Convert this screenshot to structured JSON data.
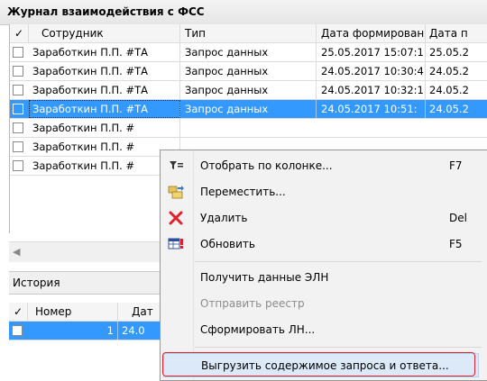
{
  "window": {
    "title": "Журнал взаимодействия с ФСС"
  },
  "grid": {
    "columns": [
      "✓",
      "Сотрудник",
      "Тип",
      "Дата формировани",
      "Дата п"
    ],
    "rows": [
      {
        "employee": "Заработкин П.П. #ТА",
        "type": "Запрос данных",
        "date1": "25.05.2017 15:07:1",
        "date2": "25.05.2"
      },
      {
        "employee": "Заработкин П.П. #ТА",
        "type": "Запрос данных",
        "date1": "24.05.2017 10:30:4",
        "date2": "24.05.2"
      },
      {
        "employee": "Заработкин П.П. #ТА",
        "type": "Запрос данных",
        "date1": "24.05.2017 10:32:1",
        "date2": "24.05.2"
      },
      {
        "employee": "Заработкин П.П. #ТА",
        "type": "Запрос данных",
        "date1": "24.05.2017 10:51:",
        "date2": "24.05.2"
      },
      {
        "employee": "Заработкин П.П. #",
        "type": "",
        "date1": "",
        "date2": ""
      },
      {
        "employee": "Заработкин П.П. #",
        "type": "",
        "date1": "",
        "date2": ""
      },
      {
        "employee": "Заработкин П.П. #",
        "type": "",
        "date1": "",
        "date2": ""
      }
    ],
    "selected_index": 3
  },
  "history": {
    "title": "История",
    "columns": [
      "✓",
      "Номер",
      "Дат"
    ],
    "rows": [
      {
        "number": "1",
        "date": "24.0"
      }
    ]
  },
  "context_menu": {
    "items": [
      {
        "icon": "filter-icon",
        "label": "Отобрать по колонке...",
        "shortcut": "F7"
      },
      {
        "icon": "move-folder-icon",
        "label": "Переместить...",
        "shortcut": ""
      },
      {
        "icon": "delete-x-icon",
        "label": "Удалить",
        "shortcut": "Del"
      },
      {
        "icon": "refresh-table-icon",
        "label": "Обновить",
        "shortcut": "F5"
      },
      {
        "label": "Получить данные ЭЛН",
        "shortcut": ""
      },
      {
        "label": "Отправить реестр",
        "shortcut": "",
        "disabled": true
      },
      {
        "label": "Сформировать ЛН...",
        "shortcut": ""
      },
      {
        "label": "Выгрузить содержимое запроса и ответа...",
        "shortcut": "",
        "highlighted": true
      }
    ]
  },
  "colors": {
    "selection": "#3399ff",
    "highlight_border": "#e0202a",
    "delete_icon": "#e0202a"
  }
}
